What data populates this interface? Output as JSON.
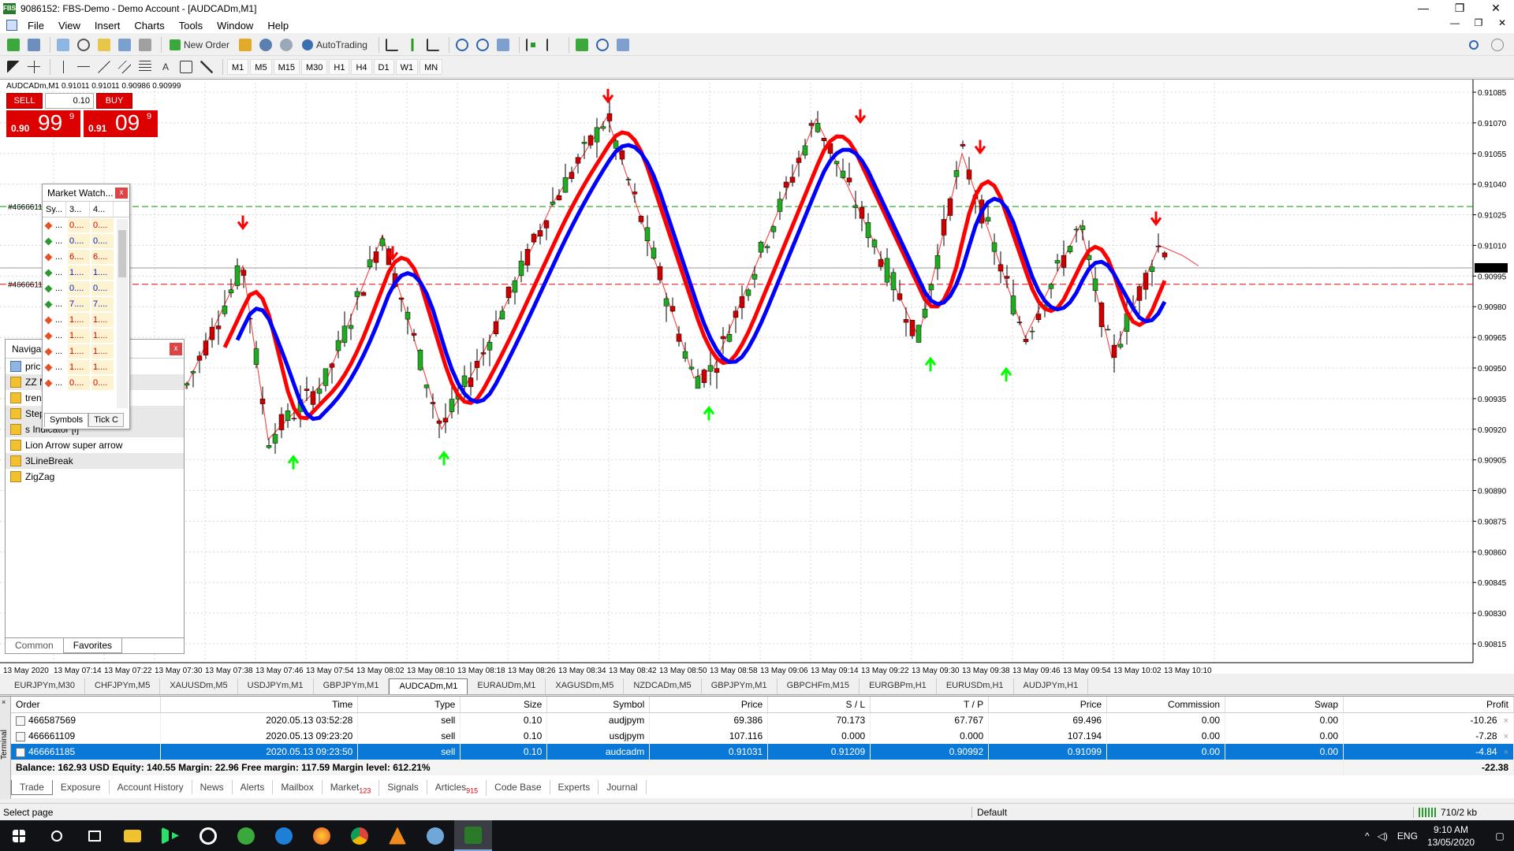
{
  "window": {
    "title": "9086152: FBS-Demo - Demo Account - [AUDCADm,M1]",
    "app_icon_text": "FBS",
    "controls": [
      "—",
      "❐",
      "✕"
    ],
    "mdi_controls": [
      "—",
      "❐",
      "✕"
    ]
  },
  "menu": [
    "File",
    "View",
    "Insert",
    "Charts",
    "Tools",
    "Window",
    "Help"
  ],
  "toolbar": {
    "new_order": "New Order",
    "autotrading": "AutoTrading",
    "timeframes": [
      "M1",
      "M5",
      "M15",
      "M30",
      "H1",
      "H4",
      "D1",
      "W1",
      "MN"
    ]
  },
  "chart": {
    "info": "AUDCADm,M1  0.91011 0.91011 0.90986 0.90999",
    "current_price_label": "0.90999",
    "order_line_labels": [
      "#4666611",
      "#4666611"
    ],
    "price_ticks": [
      "0.91085",
      "0.91070",
      "0.91055",
      "0.91040",
      "0.91025",
      "0.91010",
      "0.90995",
      "0.90980",
      "0.90965",
      "0.90950",
      "0.90935",
      "0.90920",
      "0.90905",
      "0.90890",
      "0.90875",
      "0.90860",
      "0.90845",
      "0.90830",
      "0.90815"
    ],
    "time_ticks": [
      "13 May 2020",
      "13 May 07:14",
      "13 May 07:22",
      "13 May 07:30",
      "13 May 07:38",
      "13 May 07:46",
      "13 May 07:54",
      "13 May 08:02",
      "13 May 08:10",
      "13 May 08:18",
      "13 May 08:26",
      "13 May 08:34",
      "13 May 08:42",
      "13 May 08:50",
      "13 May 08:58",
      "13 May 09:06",
      "13 May 09:14",
      "13 May 09:22",
      "13 May 09:30",
      "13 May 09:38",
      "13 May 09:46",
      "13 May 09:54",
      "13 May 10:02",
      "13 May 10:10"
    ],
    "colors": {
      "bull_candle": "#22aa22",
      "bear_candle": "#cc0000",
      "blue_line": "#0000ff",
      "red_line": "#ff0000",
      "up_arrow": "#00ff00",
      "down_arrow": "#ff0000",
      "tp_line": "#00a000",
      "sl_line": "#ff0000"
    }
  },
  "one_click": {
    "sell_label": "SELL",
    "buy_label": "BUY",
    "lot": "0.10",
    "sell_small": "0.90",
    "sell_big": "99",
    "sell_sup": "9",
    "buy_small": "0.91",
    "buy_big": "09",
    "buy_sup": "9"
  },
  "market_watch": {
    "title": "Market Watch...",
    "columns": [
      "Sy...",
      "3...",
      "4..."
    ],
    "rows": [
      {
        "sym": "...",
        "bid": "0....",
        "ask": "0....",
        "dir": "dn"
      },
      {
        "sym": "...",
        "bid": "0....",
        "ask": "0....",
        "dir": "up"
      },
      {
        "sym": "...",
        "bid": "6....",
        "ask": "6....",
        "dir": "dn"
      },
      {
        "sym": "...",
        "bid": "1....",
        "ask": "1....",
        "dir": "up"
      },
      {
        "sym": "...",
        "bid": "0....",
        "ask": "0....",
        "dir": "up"
      },
      {
        "sym": "...",
        "bid": "7....",
        "ask": "7....",
        "dir": "up"
      },
      {
        "sym": "...",
        "bid": "1....",
        "ask": "1....",
        "dir": "dn"
      },
      {
        "sym": "...",
        "bid": "1....",
        "ask": "1....",
        "dir": "dn"
      },
      {
        "sym": "...",
        "bid": "1....",
        "ask": "1....",
        "dir": "dn"
      },
      {
        "sym": "...",
        "bid": "1....",
        "ask": "1....",
        "dir": "dn"
      },
      {
        "sym": "...",
        "bid": "0....",
        "ask": "0....",
        "dir": "dn"
      }
    ],
    "tabs": [
      "Symbols",
      "Tick C"
    ]
  },
  "navigator": {
    "title": "Navigat",
    "items": [
      "pric",
      "ZZ M",
      "tren",
      "Step",
      "s Indicator [i]",
      "Lion Arrow super arrow",
      "3LineBreak",
      "ZigZag"
    ],
    "tabs": [
      "Common",
      "Favorites"
    ]
  },
  "symbol_tabs": [
    "EURJPYm,M30",
    "CHFJPYm,M5",
    "XAUUSDm,M5",
    "USDJPYm,M1",
    "GBPJPYm,M1",
    "AUDCADm,M1",
    "EURAUDm,M1",
    "XAGUSDm,M5",
    "NZDCADm,M5",
    "GBPJPYm,M1",
    "GBPCHFm,M15",
    "EURGBPm,H1",
    "EURUSDm,H1",
    "AUDJPYm,H1"
  ],
  "terminal": {
    "side_label": "Terminal",
    "columns": [
      "Order",
      "Time",
      "Type",
      "Size",
      "Symbol",
      "Price",
      "S / L",
      "T / P",
      "Price",
      "Commission",
      "Swap",
      "Profit"
    ],
    "orders": [
      {
        "order": "466587569",
        "time": "2020.05.13 03:52:28",
        "type": "sell",
        "size": "0.10",
        "symbol": "audjpym",
        "price": "69.386",
        "sl": "70.173",
        "tp": "67.767",
        "cur": "69.496",
        "commission": "0.00",
        "swap": "0.00",
        "profit": "-10.26"
      },
      {
        "order": "466661109",
        "time": "2020.05.13 09:23:20",
        "type": "sell",
        "size": "0.10",
        "symbol": "usdjpym",
        "price": "107.116",
        "sl": "0.000",
        "tp": "0.000",
        "cur": "107.194",
        "commission": "0.00",
        "swap": "0.00",
        "profit": "-7.28"
      },
      {
        "order": "466661185",
        "time": "2020.05.13 09:23:50",
        "type": "sell",
        "size": "0.10",
        "symbol": "audcadm",
        "price": "0.91031",
        "sl": "0.91209",
        "tp": "0.90992",
        "cur": "0.91099",
        "commission": "0.00",
        "swap": "0.00",
        "profit": "-4.84"
      }
    ],
    "balance_line": "Balance: 162.93 USD  Equity: 140.55  Margin: 22.96  Free margin: 117.59  Margin level: 612.21%",
    "total_profit": "-22.38",
    "tabs": [
      "Trade",
      "Exposure",
      "Account History",
      "News",
      "Alerts",
      "Mailbox",
      "Market",
      "Signals",
      "Articles",
      "Code Base",
      "Experts",
      "Journal"
    ],
    "market_badge": "123",
    "articles_badge": "915"
  },
  "status": {
    "left": "Select page",
    "profile": "Default",
    "traffic": "710/2 kb"
  },
  "taskbar": {
    "lang": "ENG",
    "time": "9:10 AM",
    "date": "13/05/2020"
  }
}
